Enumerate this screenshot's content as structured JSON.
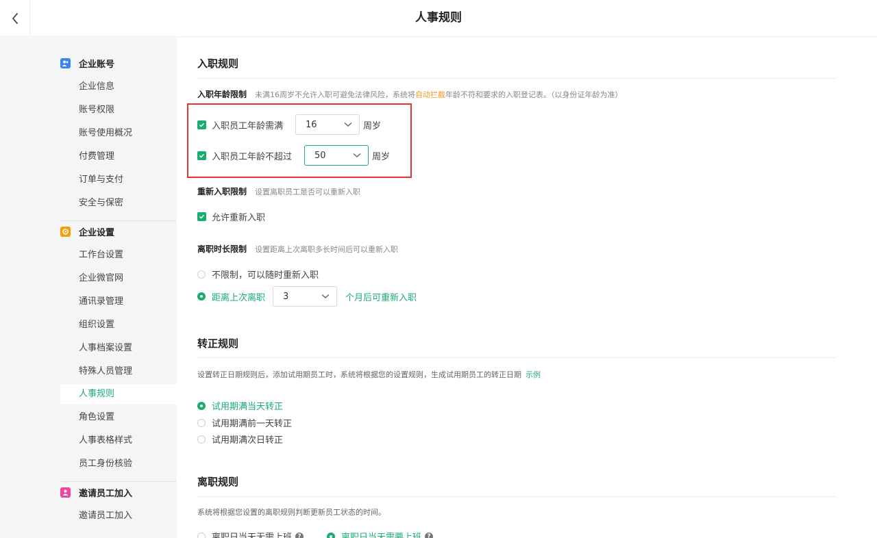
{
  "header": {
    "title": "人事规则",
    "back_icon": "chevron-left-icon"
  },
  "sidebar": {
    "groups": [
      {
        "title": "企业账号",
        "icon": "users-icon",
        "color": "#3b82f6",
        "items": [
          "企业信息",
          "账号权限",
          "账号使用概况",
          "付费管理",
          "订单与支付",
          "安全与保密"
        ]
      },
      {
        "title": "企业设置",
        "icon": "settings-icon",
        "color": "#f59e0b",
        "items": [
          "工作台设置",
          "企业微官网",
          "通讯录管理",
          "组织设置",
          "人事档案设置",
          "特殊人员管理",
          "人事规则",
          "角色设置",
          "人事表格样式",
          "员工身份核验"
        ]
      },
      {
        "title": "邀请员工加入",
        "icon": "invite-user-icon",
        "color": "#ec4899",
        "items": [
          "邀请员工加入"
        ]
      }
    ],
    "active_item": "人事规则"
  },
  "onboarding": {
    "title": "入职规则",
    "age_limit": {
      "label": "入职年龄限制",
      "desc_prefix": "未满16周岁不允许入职可避免法律风险，系统将",
      "desc_highlight": "自动拦截",
      "desc_suffix": "年龄不符和要求的入职登记表。（以身份证年龄为准）",
      "min": {
        "label": "入职员工年龄需满",
        "value": "16",
        "unit": "周岁",
        "checked": true
      },
      "max": {
        "label": "入职员工年龄不超过",
        "value": "50",
        "unit": "周岁",
        "checked": true
      }
    },
    "rehire": {
      "label": "重新入职限制",
      "desc": "设置离职员工是否可以重新入职",
      "option": "允许重新入职",
      "checked": true
    },
    "leave_duration": {
      "label": "离职时长限制",
      "desc": "设置距离上次离职多长时间后可以重新入职",
      "option_unlimited": "不限制，可以随时重新入职",
      "option_since_prefix": "距离上次离职",
      "months_value": "3",
      "option_since_suffix": "个月后可重新入职",
      "selected": "since"
    }
  },
  "regularization": {
    "title": "转正规则",
    "desc": "设置转正日期规则后，添加试用期员工时，系统将根据您的设置规则，生成试用期员工的转正日期",
    "example_link": "示例",
    "options": [
      "试用期满当天转正",
      "试用期满前一天转正",
      "试用期满次日转正"
    ],
    "selected": 0
  },
  "resignation": {
    "title": "离职规则",
    "desc": "系统将根据您设置的离职规则判断更新员工状态的时间。",
    "options": [
      "离职日当天无需上班",
      "离职日当天需要上班"
    ],
    "selected": 1
  },
  "colors": {
    "accent": "#1aad6f",
    "warning": "#f59a23",
    "highlight_box": "#e53333"
  }
}
